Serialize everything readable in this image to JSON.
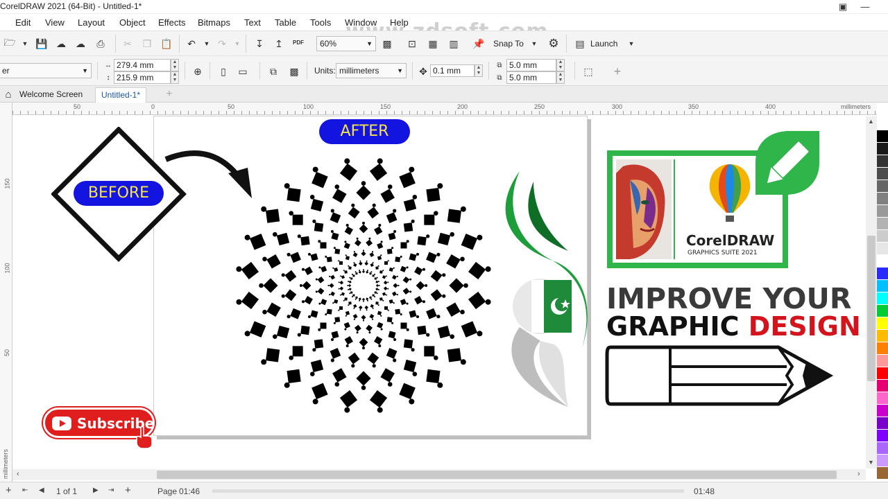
{
  "titlebar": {
    "title": "CorelDRAW 2021 (64-Bit) - Untitled-1*"
  },
  "menu": [
    "Edit",
    "View",
    "Layout",
    "Object",
    "Effects",
    "Bitmaps",
    "Text",
    "Table",
    "Tools",
    "Window",
    "Help"
  ],
  "toolbar1": {
    "zoom": "60%",
    "snap_label": "Snap To",
    "launch_label": "Launch",
    "watermark": "www.zdsoft.com",
    "pdf_label": "PDF"
  },
  "toolbar2": {
    "preset_value": "er",
    "width": "279.4 mm",
    "height": "215.9 mm",
    "units_label": "Units:",
    "units_value": "millimeters",
    "nudge": "0.1 mm",
    "dup_x": "5.0 mm",
    "dup_y": "5.0 mm"
  },
  "tabs": [
    {
      "label": "Welcome Screen"
    },
    {
      "label": "Untitled-1*"
    }
  ],
  "hruler": {
    "ticks": [
      "50",
      "0",
      "50",
      "100",
      "150",
      "200",
      "250",
      "300",
      "350",
      "400"
    ],
    "unit": "millimeters"
  },
  "vruler": {
    "ticks": [
      "150",
      "100",
      "50"
    ],
    "unit": "millimeters"
  },
  "artwork": {
    "before_label": "BEFORE",
    "after_label": "AFTER",
    "subscribe_label": "Subscribe",
    "brand_name": "CorelDRAW",
    "brand_sub": "GRAPHICS SUITE 2021",
    "headline_line1": "IMPROVE YOUR",
    "headline_line2a": "GRAPHIC",
    "headline_line2b": "DESIGN",
    "colors": {
      "blue_pill": "#1414e0",
      "before_text": "#f5e34a",
      "after_text": "#f5e34a",
      "headline_dark": "#3a3a3a",
      "headline_red": "#d4141c",
      "green": "#1e9e3a",
      "subscribe_red": "#e01e1e"
    }
  },
  "status": {
    "page_label": "Page",
    "pages": "1 of 1",
    "time_current": "01:46",
    "time_total": "01:48"
  },
  "palette": [
    "#ffffff",
    "#000000",
    "#1a1a1a",
    "#333333",
    "#4d4d4d",
    "#666666",
    "#808080",
    "#999999",
    "#b3b3b3",
    "#cccccc",
    "#e6e6e6",
    "#ffffff",
    "#2a2aff",
    "#00c0ff",
    "#00ffff",
    "#00cc33",
    "#ffff00",
    "#ffbb00",
    "#ff8000",
    "#ff9999",
    "#ff0000",
    "#e60073",
    "#ff66cc",
    "#cc00cc",
    "#7a00cc",
    "#8000ff",
    "#aa66ff",
    "#cc99ff",
    "#996633"
  ]
}
